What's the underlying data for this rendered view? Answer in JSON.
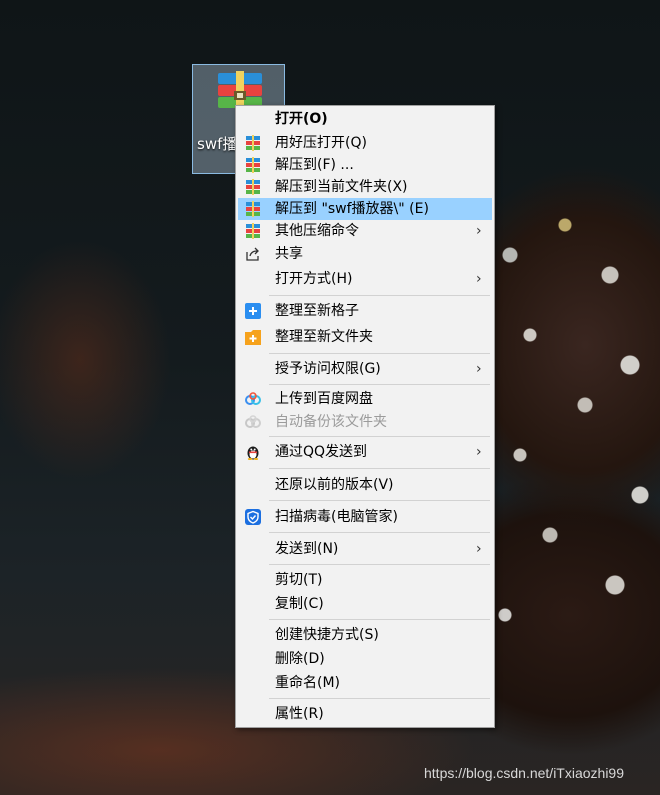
{
  "desktop_file": {
    "name": "swf播",
    "icon": "winrar-archive-icon"
  },
  "context_menu": {
    "items": [
      {
        "label": "打开(O)"
      },
      {
        "label": "用好压打开(Q)",
        "icon": "haozip-icon"
      },
      {
        "label": "解压到(F) ...",
        "icon": "haozip-icon"
      },
      {
        "label": "解压到当前文件夹(X)",
        "icon": "haozip-icon"
      },
      {
        "label": "解压到 \"swf播放器\\\" (E)",
        "icon": "haozip-icon"
      },
      {
        "label": "其他压缩命令",
        "icon": "haozip-icon",
        "submenu": "›"
      },
      {
        "label": "共享",
        "icon": "share-icon"
      },
      {
        "label": "打开方式(H)",
        "submenu": "›"
      },
      {
        "label": "整理至新格子",
        "icon": "blue-plus-icon"
      },
      {
        "label": "整理至新文件夹",
        "icon": "orange-plus-icon"
      },
      {
        "label": "授予访问权限(G)",
        "submenu": "›"
      },
      {
        "label": "上传到百度网盘",
        "icon": "baidu-netdisk-icon"
      },
      {
        "label": "自动备份该文件夹",
        "icon": "baidu-netdisk-icon"
      },
      {
        "label": "通过QQ发送到",
        "icon": "qq-penguin-icon",
        "submenu": "›"
      },
      {
        "label": "还原以前的版本(V)"
      },
      {
        "label": "扫描病毒(电脑管家)",
        "icon": "pc-manager-shield-icon"
      },
      {
        "label": "发送到(N)",
        "submenu": "›"
      },
      {
        "label": "剪切(T)"
      },
      {
        "label": "复制(C)"
      },
      {
        "label": "创建快捷方式(S)"
      },
      {
        "label": "删除(D)"
      },
      {
        "label": "重命名(M)"
      },
      {
        "label": "属性(R)"
      }
    ]
  },
  "watermark": "https://blog.csdn.net/iTxiaozhi99",
  "colors": {
    "menu_background": "#f2f2f2",
    "highlight": "#99d1ff",
    "disabled_text": "#9b9b9b"
  }
}
